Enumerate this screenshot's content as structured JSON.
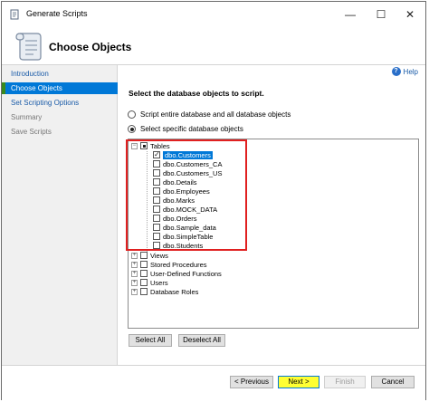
{
  "window": {
    "title": "Generate Scripts",
    "minimize": "—",
    "maximize": "☐",
    "close": "✕"
  },
  "header": {
    "title": "Choose Objects"
  },
  "sidebar": {
    "items": [
      {
        "label": "Introduction",
        "state": "link"
      },
      {
        "label": "Choose Objects",
        "state": "active"
      },
      {
        "label": "Set Scripting Options",
        "state": "link"
      },
      {
        "label": "Summary",
        "state": "disabled"
      },
      {
        "label": "Save Scripts",
        "state": "disabled"
      }
    ]
  },
  "content": {
    "help_label": "Help",
    "instruction": "Select the database objects to script.",
    "radio_all": "Script entire database and all database objects",
    "radio_specific": "Select specific database objects",
    "tree": {
      "tables_label": "Tables",
      "tables": [
        "dbo.Customers",
        "dbo.Customers_CA",
        "dbo.Customers_US",
        "dbo.Details",
        "dbo.Employees",
        "dbo.Marks",
        "dbo.MOCK_DATA",
        "dbo.Orders",
        "dbo.Sample_data",
        "dbo.SimpleTable",
        "dbo.Students"
      ],
      "other_nodes": [
        "Views",
        "Stored Procedures",
        "User-Defined Functions",
        "Users",
        "Database Roles"
      ]
    },
    "select_all": "Select All",
    "deselect_all": "Deselect All"
  },
  "footer": {
    "previous": "< Previous",
    "next": "Next >",
    "finish": "Finish",
    "cancel": "Cancel"
  },
  "colors": {
    "accent": "#0078d7",
    "highlight_box": "#e02020",
    "next_highlight": "#ffff33"
  }
}
